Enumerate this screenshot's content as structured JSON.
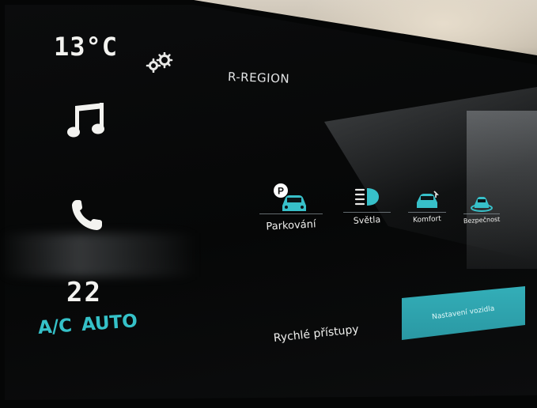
{
  "left_column": {
    "outside_temperature": "13°C",
    "cabin_temperature": "22",
    "ac_label": "A/C",
    "auto_label": "AUTO"
  },
  "header": {
    "region": "R-REGION"
  },
  "categories": [
    {
      "label": "Parkování",
      "icon": "parking-car-icon"
    },
    {
      "label": "Světla",
      "icon": "headlight-icon"
    },
    {
      "label": "Komfort",
      "icon": "comfort-car-icon"
    },
    {
      "label": "Bezpečnost",
      "icon": "safety-car-icon"
    }
  ],
  "bottom": {
    "quick_access": "Rychlé přístupy",
    "vehicle_settings_button": "Nastavení vozidla"
  },
  "colors": {
    "accent": "#35c1c8",
    "button": "#2fa6b0",
    "screen": "#060707"
  },
  "icons": [
    "gear-icon",
    "music-icon",
    "phone-icon"
  ]
}
